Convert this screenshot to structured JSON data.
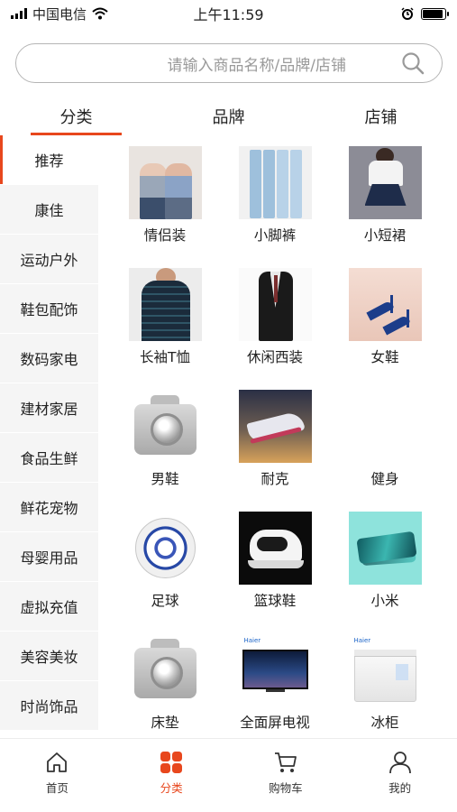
{
  "status_bar": {
    "carrier": "中国电信",
    "time": "上午11:59",
    "battery_level": 0.9
  },
  "search": {
    "placeholder": "请输入商品名称/品牌/店铺",
    "icon": "search-icon"
  },
  "top_tabs": [
    {
      "label": "分类",
      "active": true
    },
    {
      "label": "品牌",
      "active": false
    },
    {
      "label": "店铺",
      "active": false
    }
  ],
  "sidebar": {
    "items": [
      {
        "label": "推荐",
        "active": true
      },
      {
        "label": "康佳"
      },
      {
        "label": "运动户外"
      },
      {
        "label": "鞋包配饰"
      },
      {
        "label": "数码家电"
      },
      {
        "label": "建材家居"
      },
      {
        "label": "食品生鲜"
      },
      {
        "label": "鲜花宠物"
      },
      {
        "label": "母婴用品"
      },
      {
        "label": "虚拟充值"
      },
      {
        "label": "美容美妆"
      },
      {
        "label": "时尚饰品"
      }
    ]
  },
  "grid": {
    "items": [
      {
        "label": "情侣装",
        "image": "couple-clothes"
      },
      {
        "label": "小脚裤",
        "image": "skinny-jeans"
      },
      {
        "label": "小短裙",
        "image": "short-skirt"
      },
      {
        "label": "长袖T恤",
        "image": "long-sleeve-tshirt"
      },
      {
        "label": "休闲西装",
        "image": "casual-suit"
      },
      {
        "label": "女鞋",
        "image": "womens-heels"
      },
      {
        "label": "男鞋",
        "image": "camera-placeholder"
      },
      {
        "label": "耐克",
        "image": "nike-shoe"
      },
      {
        "label": "健身",
        "image": "none"
      },
      {
        "label": "足球",
        "image": "soccer-ball"
      },
      {
        "label": "篮球鞋",
        "image": "basketball-shoe"
      },
      {
        "label": "小米",
        "image": "xiaomi-phone"
      },
      {
        "label": "床垫",
        "image": "camera-placeholder"
      },
      {
        "label": "全面屏电视",
        "image": "tv",
        "brand": "Haier"
      },
      {
        "label": "冰柜",
        "image": "freezer",
        "brand": "Haier"
      }
    ]
  },
  "bottom_nav": [
    {
      "label": "首页",
      "icon": "home-icon",
      "active": false
    },
    {
      "label": "分类",
      "icon": "category-grid-icon",
      "active": true
    },
    {
      "label": "购物车",
      "icon": "cart-icon",
      "active": false
    },
    {
      "label": "我的",
      "icon": "user-icon",
      "active": false
    }
  ],
  "colors": {
    "accent": "#e8471d",
    "sidebar_bg": "#f5f5f5",
    "placeholder": "#9a9a9a"
  }
}
